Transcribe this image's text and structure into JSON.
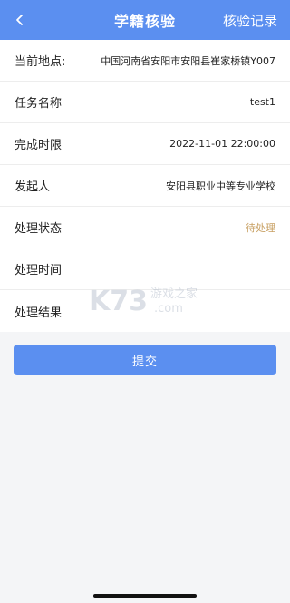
{
  "header": {
    "title": "学籍核验",
    "action_label": "核验记录",
    "back_icon": "chevron-left-icon"
  },
  "rows": [
    {
      "label": "当前地点:",
      "value": "中国河南省安阳市安阳县崔家桥镇Y007"
    },
    {
      "label": "任务名称",
      "value": "test1"
    },
    {
      "label": "完成时限",
      "value": "2022-11-01 22:00:00"
    },
    {
      "label": "发起人",
      "value": "安阳县职业中等专业学校"
    },
    {
      "label": "处理状态",
      "value": "待处理"
    },
    {
      "label": "处理时间",
      "value": ""
    },
    {
      "label": "处理结果",
      "value": ""
    }
  ],
  "submit_label": "提交",
  "watermark": {
    "brand": "K73",
    "text": "游戏之家",
    "domain": ".com"
  },
  "colors": {
    "accent": "#5b8ff0",
    "status_pending": "#c8a063",
    "background": "#f4f5f7"
  }
}
